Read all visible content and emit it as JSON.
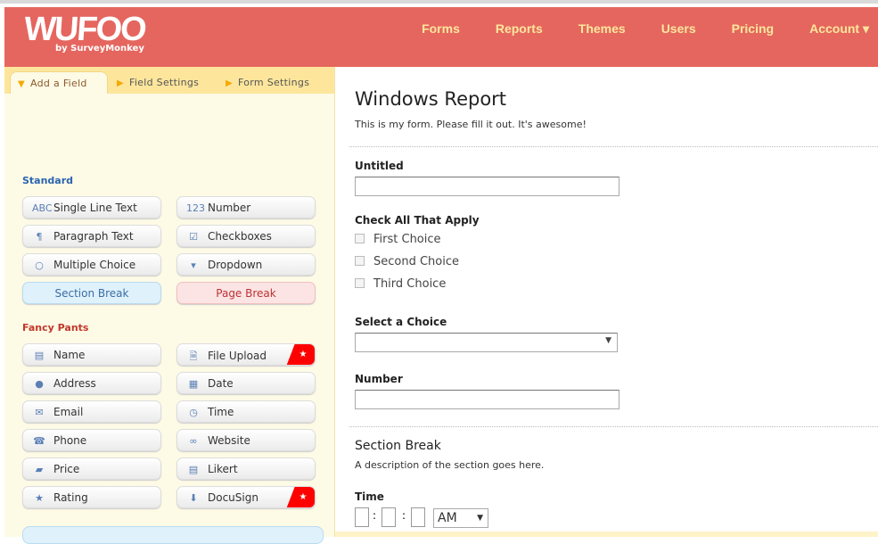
{
  "header": {
    "logo": "WUFOO",
    "logo_sub": "by SurveyMonkey",
    "nav": [
      "Forms",
      "Reports",
      "Themes",
      "Users",
      "Pricing",
      "Account ▾"
    ]
  },
  "tabs": [
    "Add a Field",
    "Field Settings",
    "Form Settings"
  ],
  "standard": {
    "title": "Standard",
    "items": [
      {
        "icon": "abc-icon",
        "glyph": "ABC",
        "label": "Single Line Text"
      },
      {
        "icon": "number-icon",
        "glyph": "123",
        "label": "Number"
      },
      {
        "icon": "paragraph-icon",
        "glyph": "¶",
        "label": "Paragraph Text"
      },
      {
        "icon": "checkbox-icon",
        "glyph": "☑",
        "label": "Checkboxes"
      },
      {
        "icon": "radio-icon",
        "glyph": "○",
        "label": "Multiple Choice"
      },
      {
        "icon": "dropdown-icon",
        "glyph": "▾",
        "label": "Dropdown"
      }
    ],
    "section_break": "Section Break",
    "page_break": "Page Break"
  },
  "fancy": {
    "title": "Fancy Pants",
    "items": [
      {
        "icon": "name-card-icon",
        "glyph": "▤",
        "label": "Name"
      },
      {
        "icon": "file-upload-icon",
        "glyph": "🗎",
        "label": "File Upload",
        "badge": "★"
      },
      {
        "icon": "globe-icon",
        "glyph": "●",
        "label": "Address"
      },
      {
        "icon": "calendar-icon",
        "glyph": "▦",
        "label": "Date"
      },
      {
        "icon": "envelope-icon",
        "glyph": "✉",
        "label": "Email"
      },
      {
        "icon": "clock-icon",
        "glyph": "◷",
        "label": "Time"
      },
      {
        "icon": "phone-icon",
        "glyph": "☎",
        "label": "Phone"
      },
      {
        "icon": "link-icon",
        "glyph": "∞",
        "label": "Website"
      },
      {
        "icon": "money-icon",
        "glyph": "▰",
        "label": "Price"
      },
      {
        "icon": "likert-icon",
        "glyph": "▤",
        "label": "Likert"
      },
      {
        "icon": "star-icon",
        "glyph": "★",
        "label": "Rating"
      },
      {
        "icon": "docusign-icon",
        "glyph": "⬇",
        "label": "DocuSign",
        "badge": "★"
      }
    ]
  },
  "form": {
    "title": "Windows Report",
    "description": "This is my form. Please fill it out. It's awesome!",
    "untitled": "Untitled",
    "check_label": "Check All That Apply",
    "choices": [
      "First Choice",
      "Second Choice",
      "Third Choice"
    ],
    "select_label": "Select a Choice",
    "number_label": "Number",
    "section_title": "Section Break",
    "section_desc": "A description of the section goes here.",
    "time_label": "Time",
    "ampm": "AM"
  },
  "colors": {
    "header": "#e5665f",
    "nav": "#fde69c",
    "panel": "#fdfae6"
  }
}
